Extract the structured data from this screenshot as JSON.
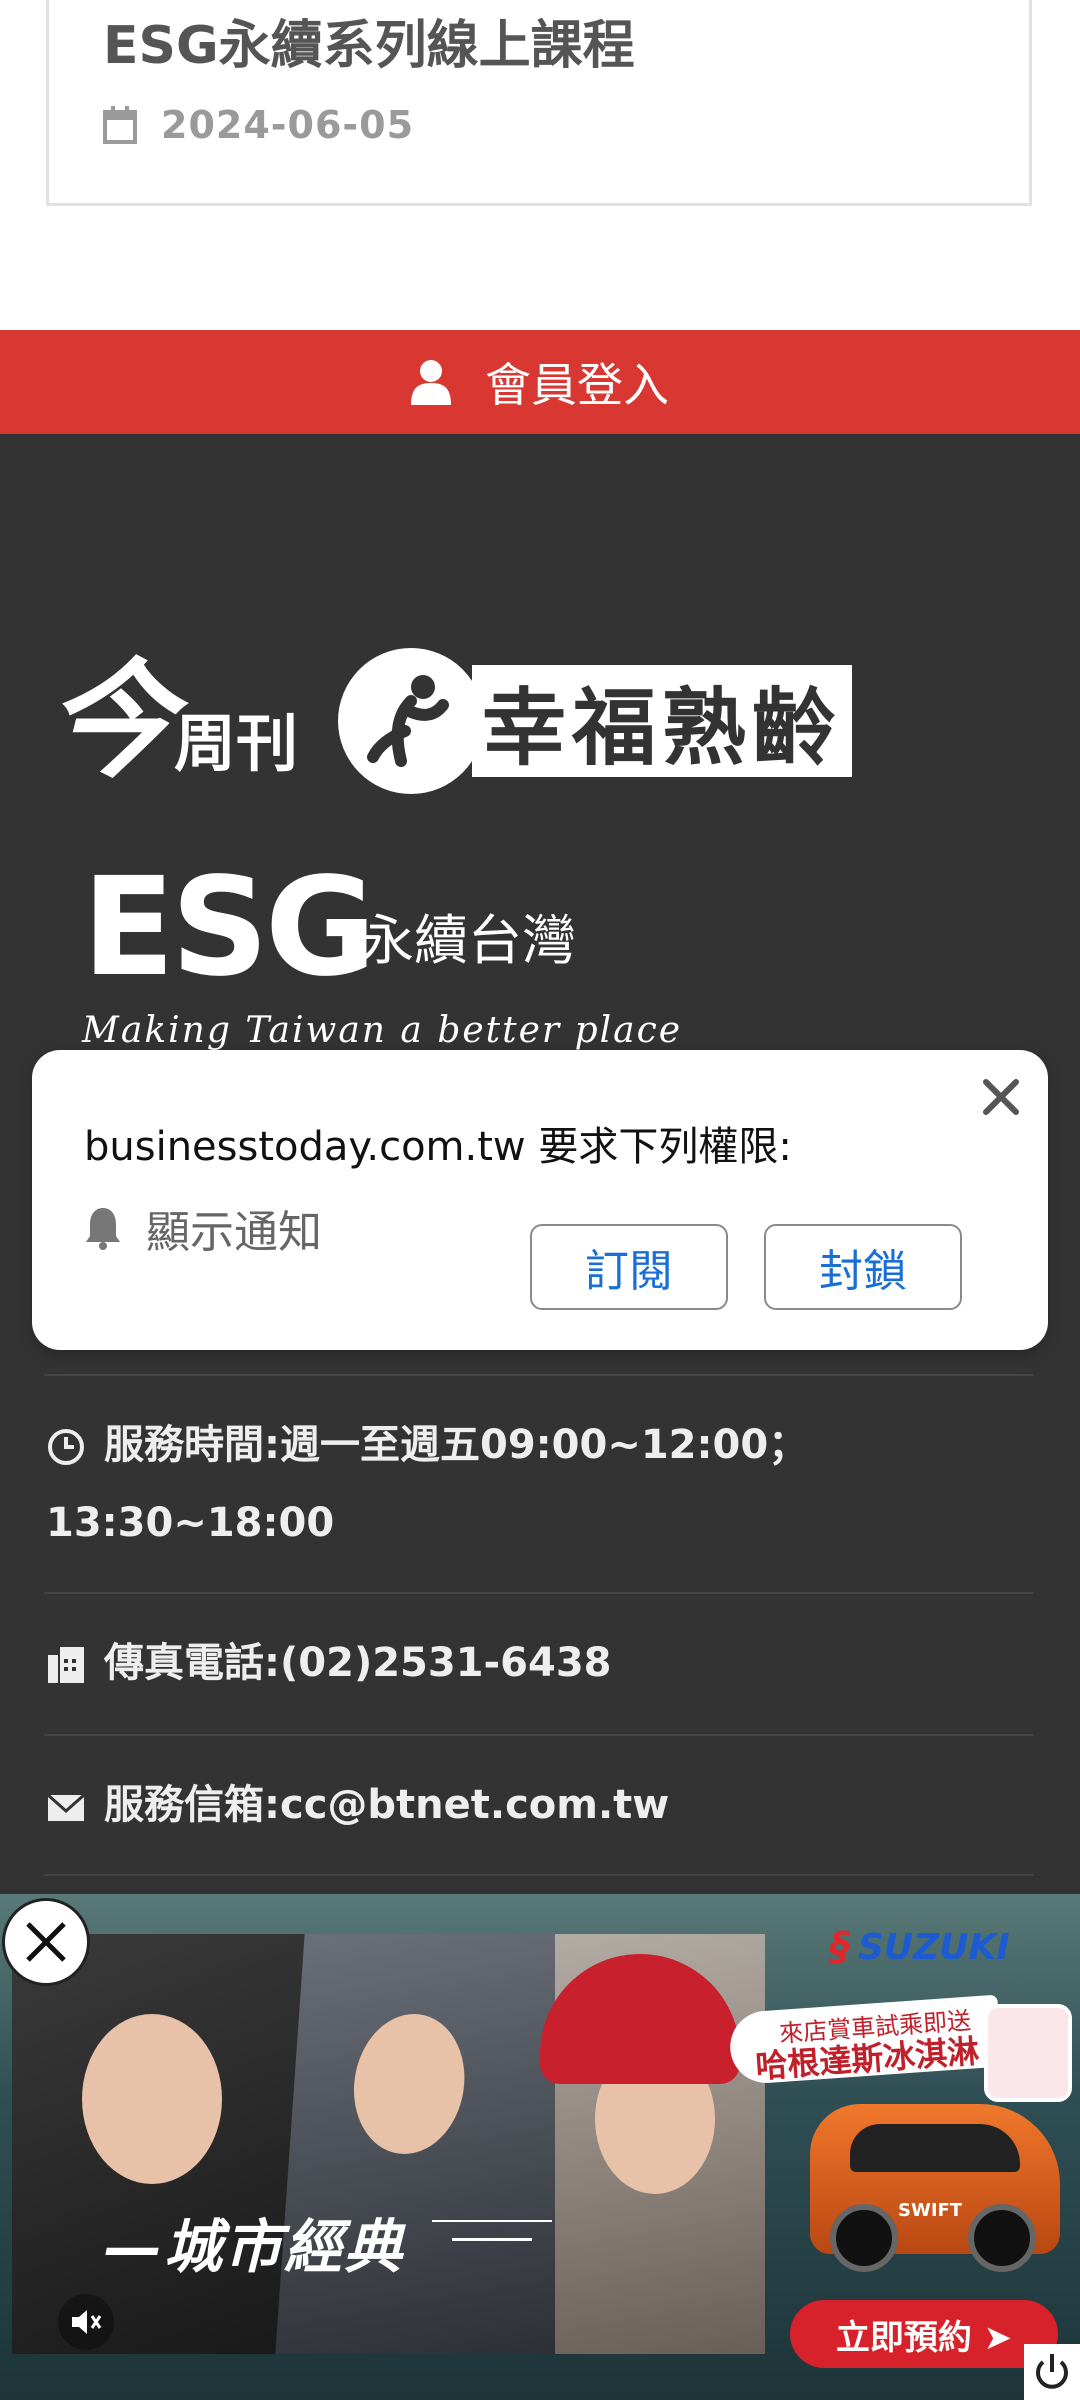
{
  "article": {
    "title": "ESG永續系列線上課程",
    "date": "2024-06-05"
  },
  "login_bar": {
    "label": "會員登入"
  },
  "logos": {
    "bt_big": "今",
    "bt_small": "周刊",
    "happy_aging": "幸福熟齡",
    "esg_mark": "ESG",
    "esg_name": "永續台灣",
    "esg_tagline": "Making Taiwan a better place"
  },
  "contact": {
    "hours": "服務時間:週一至週五09:00~12:00；",
    "hours_line2": "13:30~18:00",
    "fax": "傳真電話:(02)2531-6438",
    "email": "服務信箱:cc@btnet.com.tw"
  },
  "permission_prompt": {
    "title": "businesstoday.com.tw 要求下列權限:",
    "item": "顯示通知",
    "subscribe": "訂閱",
    "block": "封鎖"
  },
  "ad": {
    "slogan": "—城市經典",
    "brand": "SUZUKI",
    "promo_line1": "來店賞車試乘即送",
    "promo_line2": "哈根達斯冰淇淋",
    "car_badge": "SWIFT",
    "cta": "立即預約 ➤"
  },
  "colors": {
    "accent_red": "#d93832",
    "footer_bg": "#333333",
    "link_blue": "#1a6fd6"
  }
}
